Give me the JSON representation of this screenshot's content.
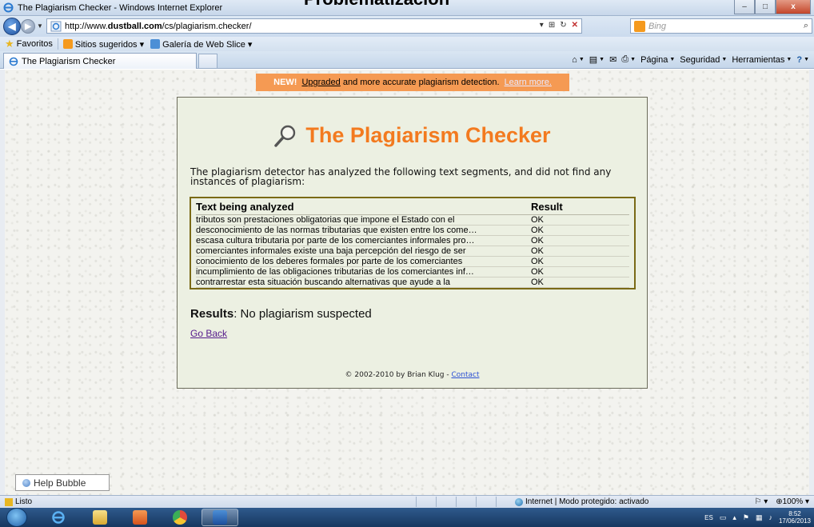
{
  "slide": {
    "heading": "Problematización"
  },
  "window": {
    "title": "The Plagiarism Checker - Windows Internet Explorer",
    "minimize_glyph": "–",
    "maximize_glyph": "□",
    "close_glyph": "x"
  },
  "address": {
    "url_prefix": "http://www.",
    "url_domain": "dustball.com",
    "url_path": "/cs/plagiarism.checker/",
    "search_placeholder": "Bing"
  },
  "favorites": {
    "label": "Favoritos",
    "items": [
      {
        "label": "Sitios sugeridos ▾"
      },
      {
        "label": "Galería de Web Slice ▾"
      }
    ]
  },
  "tab": {
    "label": "The Plagiarism Checker"
  },
  "commands": {
    "page": "Página",
    "security": "Seguridad",
    "tools": "Herramientas"
  },
  "banner": {
    "new_tag": "NEW!",
    "link": "Upgraded",
    "text": " and more accurate plagiarism detection. ",
    "learn_more": "Learn more."
  },
  "checker": {
    "title": "The Plagiarism Checker",
    "intro": "The plagiarism detector has analyzed the following text segments, and did not find any instances of plagiarism:",
    "columns": {
      "text": "Text being analyzed",
      "result": "Result"
    },
    "rows": [
      {
        "text": "tributos son prestaciones obligatorias que impone el Estado con el",
        "result": "OK"
      },
      {
        "text": "desconocimiento de las normas tributarias que existen entre los come…",
        "result": "OK"
      },
      {
        "text": "escasa cultura tributaria por parte de los comerciantes informales pro…",
        "result": "OK"
      },
      {
        "text": "comerciantes informales existe una baja percepción del riesgo de ser",
        "result": "OK"
      },
      {
        "text": "conocimiento de los deberes formales por parte de los comerciantes",
        "result": "OK"
      },
      {
        "text": "incumplimiento de las obligaciones tributarias de los comerciantes inf…",
        "result": "OK"
      },
      {
        "text": "contrarrestar esta situación buscando alternativas que ayude a la",
        "result": "OK"
      }
    ],
    "summary_label": "Results",
    "summary_value": ": No plagiarism suspected",
    "go_back": "Go Back",
    "footer_text": "© 2002-2010 by Brian Klug - ",
    "footer_link": "Contact"
  },
  "help_bubble": {
    "label": "Help Bubble"
  },
  "statusbar": {
    "left": "Listo",
    "zone": "Internet | Modo protegido: activado",
    "zoom": "100%"
  },
  "taskbar": {
    "lang": "ES",
    "time": "8:52",
    "date": "17/06/2013"
  },
  "colors": {
    "accent_orange": "#f37a1f",
    "banner_orange": "#f59a53",
    "card_bg": "#ecf0e2",
    "result_border": "#7a6a16"
  }
}
